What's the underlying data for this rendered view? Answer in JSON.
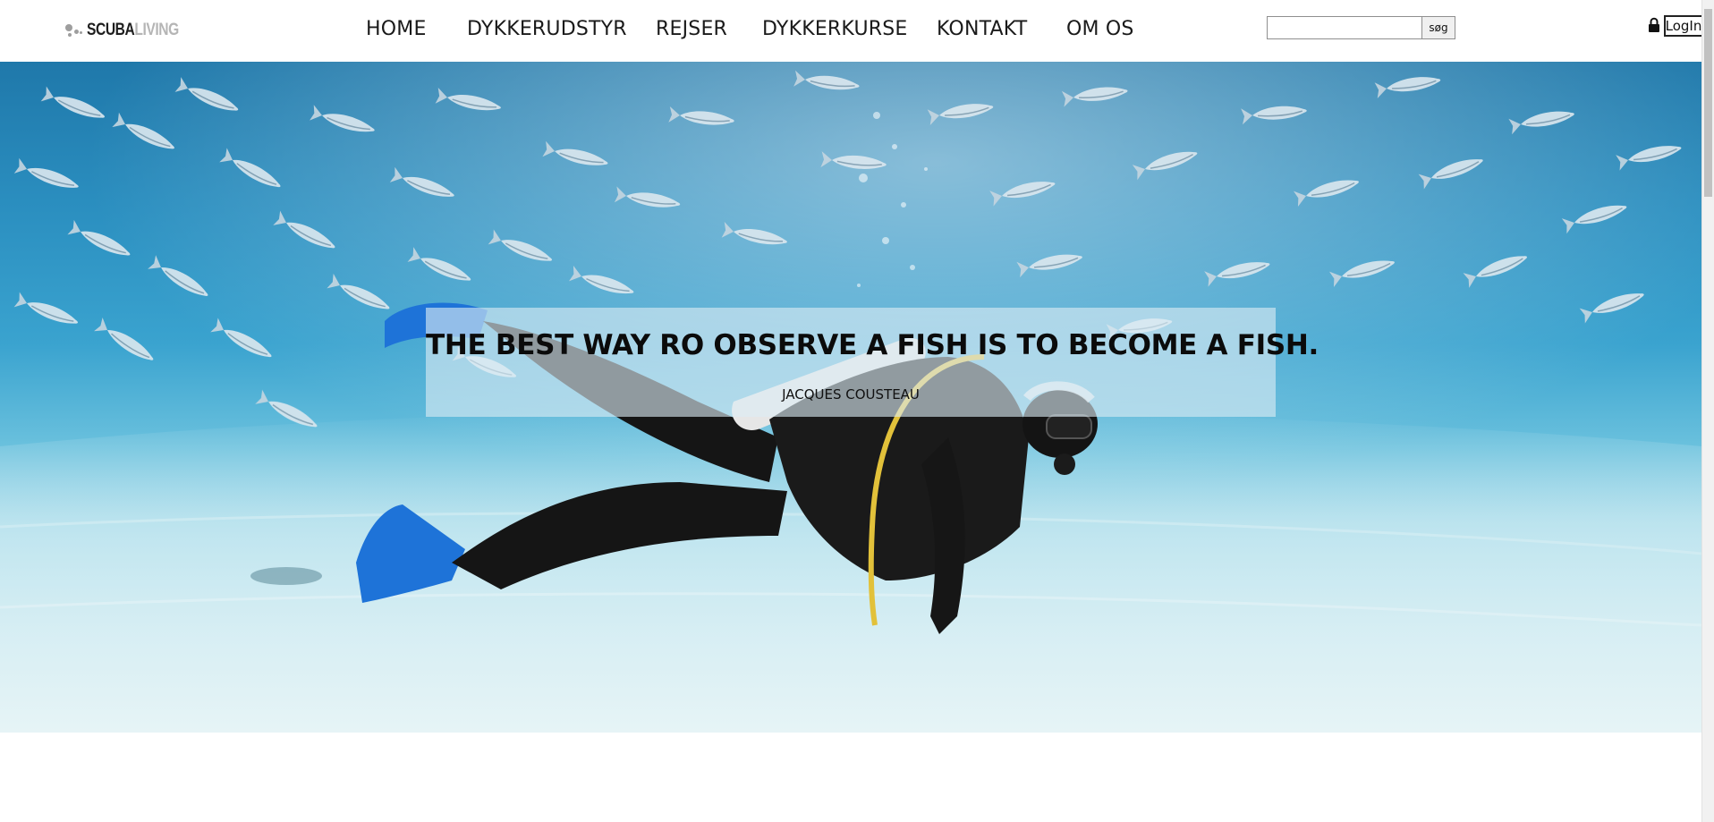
{
  "brand": {
    "name_dark": "SCUBA",
    "name_light": "LIVING",
    "icon": "bubbles-icon"
  },
  "nav": {
    "items": [
      {
        "label": "HOME"
      },
      {
        "label": "DYKKERUDSTYR"
      },
      {
        "label": "REJSER"
      },
      {
        "label": "DYKKERKURSE"
      },
      {
        "label": "KONTAKT"
      },
      {
        "label": "OM OS"
      }
    ]
  },
  "search": {
    "value": "",
    "placeholder": "",
    "button_label": "søg"
  },
  "login": {
    "label": "LogIn",
    "icon": "lock-icon"
  },
  "hero": {
    "quote": "THE BEST WAY RO OBSERVE A FISH IS TO BECOME A FISH.",
    "author": "JACQUES COUSTEAU",
    "image": "scuba-diver-with-fish-school"
  },
  "colors": {
    "text": "#1a1a1a",
    "water_deep": "#1f78aa",
    "water_light": "#dff2f6",
    "fins": "#1e73d8"
  }
}
